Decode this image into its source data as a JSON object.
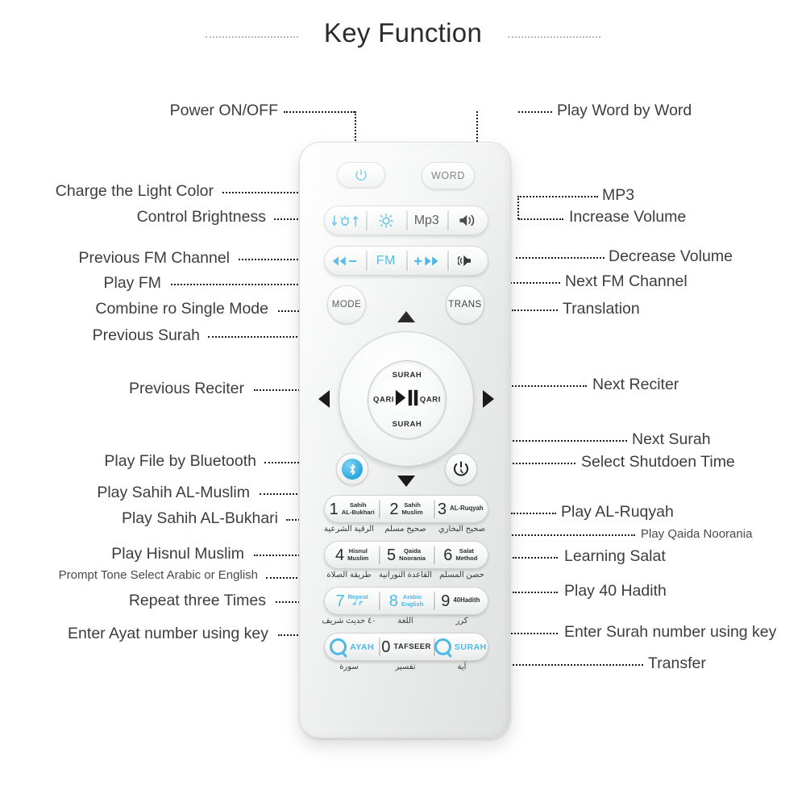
{
  "page": {
    "title": "Key Function",
    "background": "#ffffff",
    "accent_cyan": "#29a8df",
    "text_color": "#3d3d3d"
  },
  "labels_left": [
    {
      "text": "Power ON/OFF"
    },
    {
      "text": "Charge the Light Color"
    },
    {
      "text": "Control Brightness"
    },
    {
      "text": "Previous FM Channel"
    },
    {
      "text": "Play FM"
    },
    {
      "text": "Combine ro Single Mode"
    },
    {
      "text": "Previous Surah"
    },
    {
      "text": "Previous Reciter"
    },
    {
      "text": "Play File by Bluetooth"
    },
    {
      "text": "Play Sahih AL-Muslim"
    },
    {
      "text": "Play Sahih AL-Bukhari"
    },
    {
      "text": "Play Hisnul Muslim"
    },
    {
      "text": "Prompt Tone Select Arabic or English"
    },
    {
      "text": "Repeat three Times"
    },
    {
      "text": "Enter Ayat number using key"
    }
  ],
  "labels_right": [
    {
      "text": "Play Word by Word"
    },
    {
      "text": "MP3"
    },
    {
      "text": "Increase Volume"
    },
    {
      "text": "Decrease Volume"
    },
    {
      "text": "Next FM Channel"
    },
    {
      "text": "Translation"
    },
    {
      "text": "Next Reciter"
    },
    {
      "text": "Next Surah"
    },
    {
      "text": "Select Shutdoen Time"
    },
    {
      "text": "Play AL-Ruqyah"
    },
    {
      "text": "Play Qaida Noorania"
    },
    {
      "text": "Learning Salat"
    },
    {
      "text": "Play 40 Hadith"
    },
    {
      "text": "Enter Surah number using key"
    },
    {
      "text": "Transfer"
    }
  ],
  "remote": {
    "top_row": {
      "power_icon": "power-icon",
      "word_label": "WORD"
    },
    "strip1": {
      "seg1_icon": "light-color-icon",
      "seg2_icon": "brightness-icon",
      "seg3_label": "Mp3",
      "seg4_icon": "volume-up-icon"
    },
    "strip2": {
      "seg1_label": "◀◀ −",
      "seg2_label": "FM",
      "seg3_label": "+ ▶▶",
      "seg4_icon": "volume-down-icon"
    },
    "mode_label": "MODE",
    "trans_label": "TRANS",
    "wheel": {
      "top_label": "SURAH",
      "bottom_label": "SURAH",
      "left_label": "QARI",
      "right_label": "QARI",
      "center_icon": "play-pause-icon",
      "up_icon": "triangle-up-icon",
      "down_icon": "triangle-down-icon",
      "left_icon": "triangle-left-icon",
      "right_icon": "triangle-right-icon"
    },
    "bluetooth_icon": "bluetooth-icon",
    "shutdown_icon": "sleep-timer-icon",
    "keypad": [
      {
        "keys": [
          {
            "num": "1",
            "sub": "Sahih\nAL-Bukhari",
            "cyan": false
          },
          {
            "num": "2",
            "sub": "Sahih\nMuslim",
            "cyan": false
          },
          {
            "num": "3",
            "sub": "AL-Ruqyah",
            "cyan": false
          }
        ],
        "arabic": [
          "صحيح البخاري",
          "صحيح مسلم",
          "الرقية الشرعية"
        ]
      },
      {
        "keys": [
          {
            "num": "4",
            "sub": "Hisnul\nMuslim",
            "cyan": false
          },
          {
            "num": "5",
            "sub": "Qaida\nNoorania",
            "cyan": false
          },
          {
            "num": "6",
            "sub": "Salat\nMethod",
            "cyan": false
          }
        ],
        "arabic": [
          "حصن المسلم",
          "القاعدة النورانية",
          "طريقة الصلاة"
        ]
      },
      {
        "keys": [
          {
            "num": "7",
            "sub": "Repeat",
            "cyan": true
          },
          {
            "num": "8",
            "sub": "Arabic\nEnglish",
            "cyan": true
          },
          {
            "num": "9",
            "sub": "40Hadith",
            "cyan": false
          }
        ],
        "arabic": [
          "كرر",
          "اللغة",
          "٤٠ حديث شريف"
        ]
      }
    ],
    "bottom_row": {
      "ayah_label": "AYAH",
      "tafseer_num": "0",
      "tafseer_label": "TAFSEER",
      "surah_label": "SURAH",
      "arabic": [
        "آية",
        "تفسير",
        "سورة"
      ]
    }
  }
}
